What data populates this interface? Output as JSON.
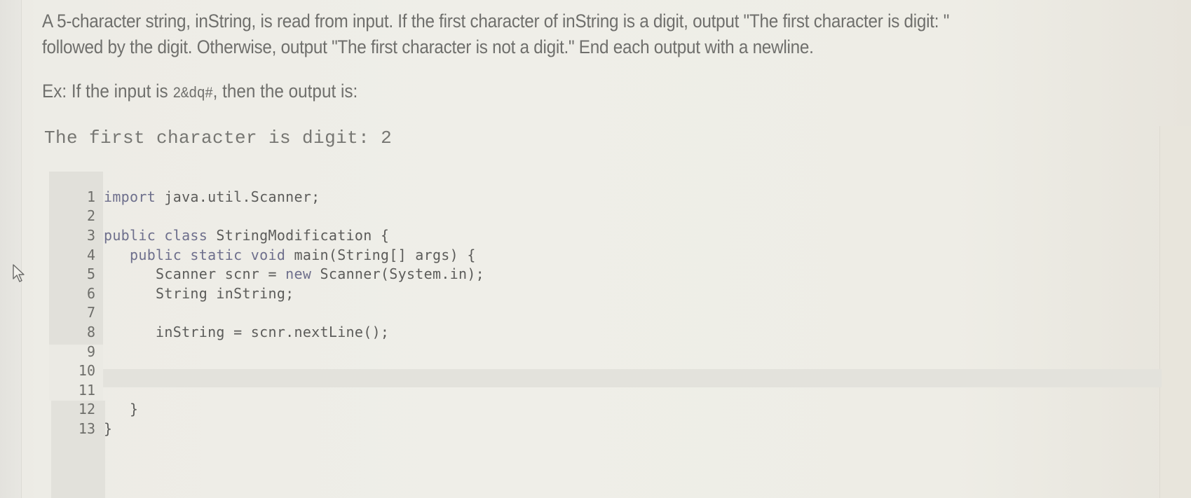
{
  "problem": {
    "description_line1": "A 5-character string, inString, is read from input. If the first character of inString is a digit, output \"The first character is digit: \"",
    "description_line2": "followed by the digit. Otherwise, output \"The first character is not a digit.\" End each output with a newline.",
    "example_prefix": "Ex: If the input is ",
    "example_input": "2&dq#",
    "example_suffix": ", then the output is:",
    "expected_output": "The first character is digit: 2"
  },
  "editor": {
    "language": "java",
    "active_line": 10,
    "lines": [
      {
        "number": "1",
        "tokens": [
          {
            "t": "import",
            "kw": true
          },
          {
            "t": " java.util.Scanner;"
          }
        ]
      },
      {
        "number": "2",
        "tokens": []
      },
      {
        "number": "3",
        "tokens": [
          {
            "t": "public class",
            "kw": true
          },
          {
            "t": " StringModification {"
          }
        ]
      },
      {
        "number": "4",
        "tokens": [
          {
            "t": "   "
          },
          {
            "t": "public static void",
            "kw": true
          },
          {
            "t": " main(String[] args) {"
          }
        ]
      },
      {
        "number": "5",
        "tokens": [
          {
            "t": "      Scanner scnr = "
          },
          {
            "t": "new",
            "kw": true
          },
          {
            "t": " Scanner(System.in);"
          }
        ]
      },
      {
        "number": "6",
        "tokens": [
          {
            "t": "      String inString;"
          }
        ]
      },
      {
        "number": "7",
        "tokens": []
      },
      {
        "number": "8",
        "tokens": [
          {
            "t": "      inString = scnr.nextLine();"
          }
        ]
      },
      {
        "number": "9",
        "tokens": []
      },
      {
        "number": "10",
        "tokens": []
      },
      {
        "number": "11",
        "tokens": []
      },
      {
        "number": "12",
        "tokens": [
          {
            "t": "   }"
          }
        ]
      },
      {
        "number": "13",
        "tokens": [
          {
            "t": "}"
          }
        ]
      }
    ]
  },
  "colors": {
    "text": "#6f6f6c",
    "keyword": "#6e6f8c",
    "code": "#5c5c5a",
    "gutter": "#e1e0da",
    "active_line": "#e3e2dc"
  }
}
